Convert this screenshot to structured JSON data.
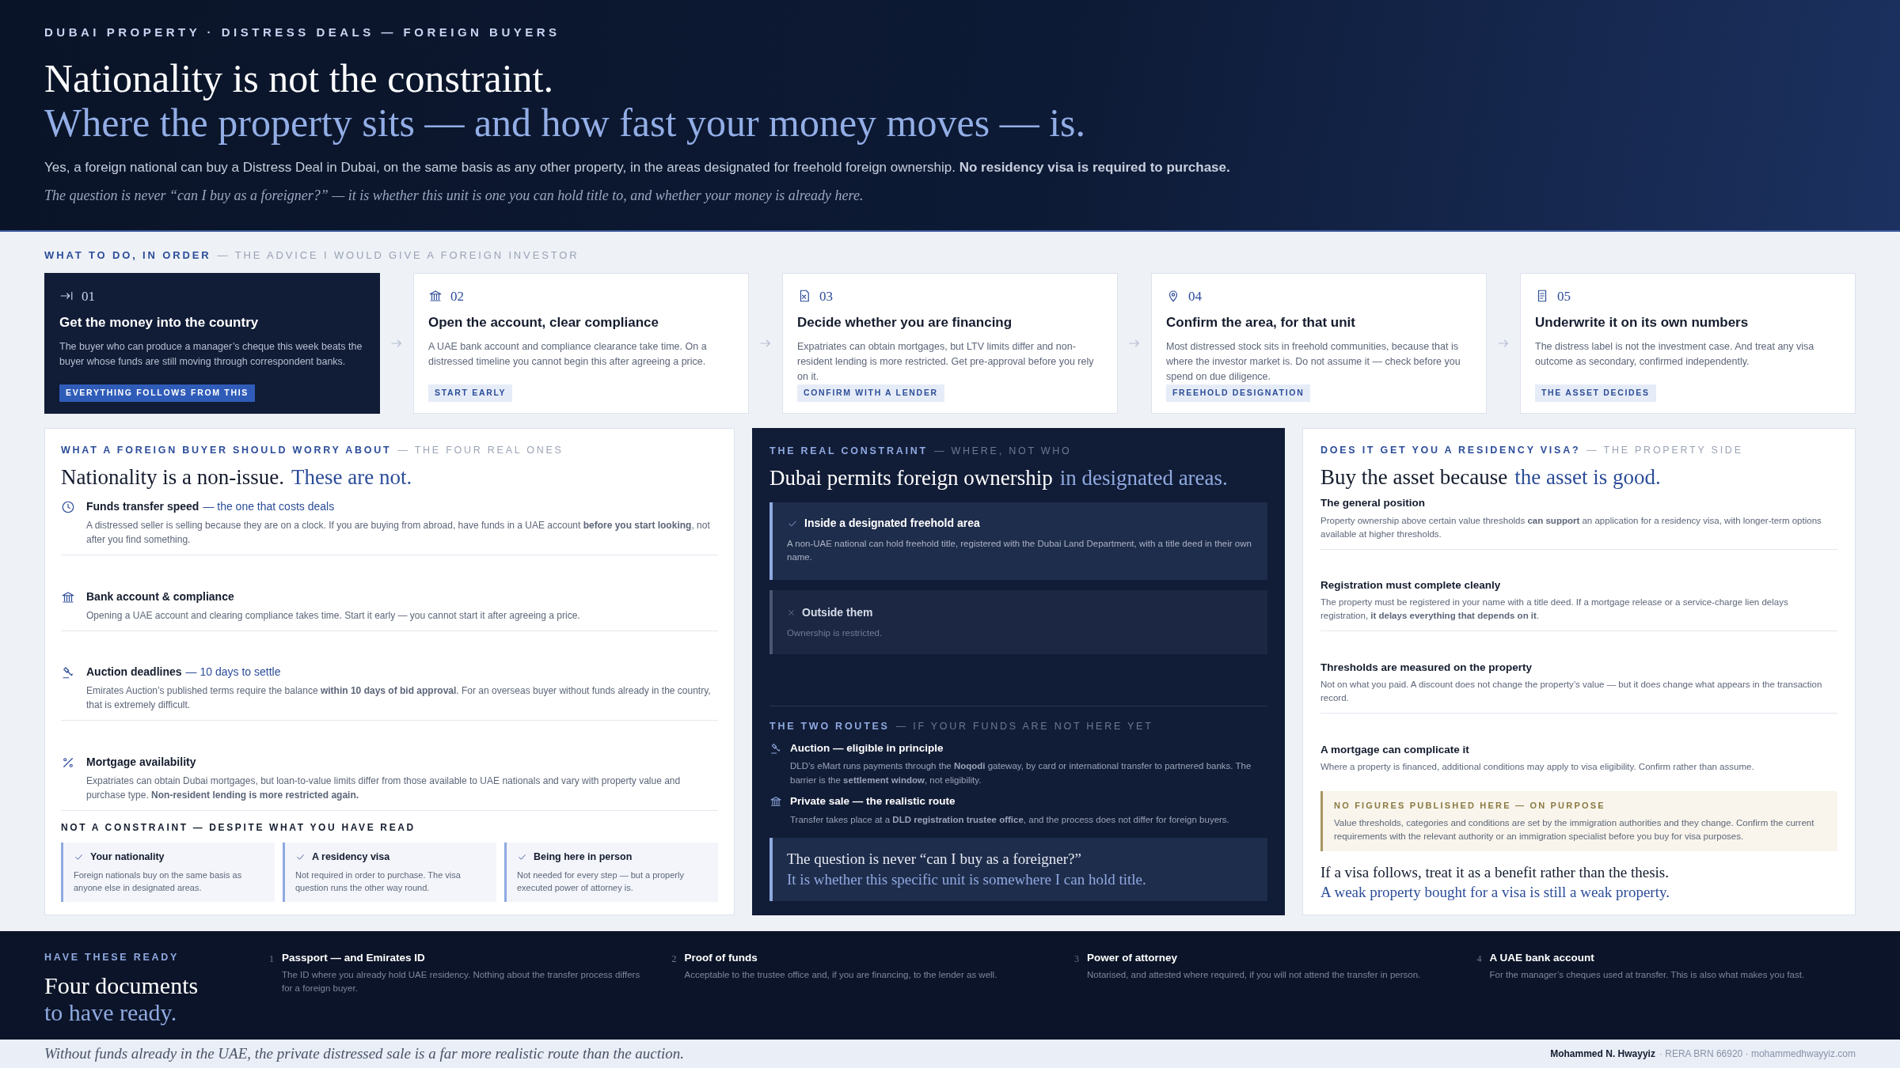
{
  "header": {
    "eyebrow": "DUBAI PROPERTY · DISTRESS DEALS — FOREIGN BUYERS",
    "title_line_1": "Nationality is not the constraint.",
    "title_line_2": "Where the property sits — and how fast your money moves — is.",
    "lede": "Yes, a foreign national can buy a Distress Deal in Dubai, on the same basis as any other property, in the areas designated for freehold foreign ownership. **No residency visa is required to purchase.**",
    "note": "The question is never “can I buy as a foreigner?” — it is whether this unit is one you can hold title to, and whether your money is already here."
  },
  "steps_section": {
    "label": "WHAT TO DO, IN ORDER",
    "label_sub": "— THE ADVICE I WOULD GIVE A FOREIGN INVESTOR",
    "steps": [
      {
        "number": "01",
        "title": "Get the money into the country",
        "body": "The buyer who can produce a manager’s cheque this week beats the buyer whose funds are still moving through correspondent banks.",
        "tag": "EVERYTHING FOLLOWS FROM THIS",
        "featured": true
      },
      {
        "number": "02",
        "title": "Open the account, clear compliance",
        "body": "A UAE bank account and compliance clearance take time. On a distressed timeline you cannot begin this after agreeing a price.",
        "tag": "START EARLY",
        "featured": false
      },
      {
        "number": "03",
        "title": "Decide whether you are financing",
        "body": "Expatriates can obtain mortgages, but LTV limits differ and non-resident lending is more restricted. Get pre-approval before you rely on it.",
        "tag": "CONFIRM WITH A LENDER",
        "featured": false
      },
      {
        "number": "04",
        "title": "Confirm the area, for that unit",
        "body": "Most distressed stock sits in freehold communities, because that is where the investor market is. Do not assume it — check before you spend on due diligence.",
        "tag": "FREEHOLD DESIGNATION",
        "featured": false
      },
      {
        "number": "05",
        "title": "Underwrite it on its own numbers",
        "body": "The distress label is not the investment case. And treat any visa outcome as secondary, confirmed independently.",
        "tag": "THE ASSET DECIDES",
        "featured": false
      }
    ]
  },
  "concerns_panel": {
    "label": "WHAT A FOREIGN BUYER SHOULD WORRY ABOUT",
    "label_sub": "— THE FOUR REAL ONES",
    "title": "Nationality is a non-issue.",
    "title_accent": "These are not.",
    "items": [
      {
        "title": "Funds transfer speed",
        "title_accent": "— the one that costs deals",
        "body": "A distressed seller is selling because they are on a clock. If you are buying from abroad, have funds in a UAE account **before you start looking**, not after you find something."
      },
      {
        "title": "Bank account & compliance",
        "body": "Opening a UAE account and clearing compliance takes time. Start it early — you cannot start it after agreeing a price."
      },
      {
        "title": "Auction deadlines",
        "title_accent": "— 10 days to settle",
        "body": "Emirates Auction’s published terms require the balance **within 10 days of bid approval**. For an overseas buyer without funds already in the country, that is extremely difficult."
      },
      {
        "title": "Mortgage availability",
        "body": "Expatriates can obtain Dubai mortgages, but loan-to-value limits differ from those available to UAE nationals and vary with property value and purchase type. **Non-resident lending is more restricted again.**"
      }
    ],
    "not_constraint": {
      "label": "NOT A CONSTRAINT — DESPITE WHAT YOU HAVE READ",
      "items": [
        {
          "title": "Your nationality",
          "body": "Foreign nationals buy on the same basis as anyone else in designated areas."
        },
        {
          "title": "A residency visa",
          "body": "Not required in order to purchase. The visa question runs the other way round."
        },
        {
          "title": "Being here in person",
          "body": "Not needed for every step — but a properly executed power of attorney is."
        }
      ]
    }
  },
  "constraint_panel": {
    "label": "THE REAL CONSTRAINT",
    "label_sub": "— WHERE, NOT WHO",
    "title": "Dubai permits foreign ownership",
    "title_accent": "in designated areas.",
    "options": [
      {
        "kind": "allowed",
        "title": "Inside a designated freehold area",
        "body": "A non-UAE national can hold freehold title, registered with the Dubai Land Department, with a title deed in their own name."
      },
      {
        "kind": "restricted",
        "title": "Outside them",
        "body": "Ownership is restricted."
      }
    ],
    "routes_label": "THE TWO ROUTES",
    "routes_label_sub": "— IF YOUR FUNDS ARE NOT HERE YET",
    "routes": [
      {
        "title": "Auction — eligible in principle",
        "body": "DLD’s eMart runs payments through the **Noqodi** gateway, by card or international transfer to partnered banks. The barrier is the **settlement window**, not eligibility."
      },
      {
        "title": "Private sale — the realistic route",
        "body": "Transfer takes place at a **DLD registration trustee office**, and the process does not differ for foreign buyers."
      }
    ],
    "quote_line_1": "The question is never “can I buy as a foreigner?”",
    "quote_line_2": "It is whether this specific unit is somewhere I can hold title."
  },
  "visa_panel": {
    "label": "DOES IT GET YOU A RESIDENCY VISA?",
    "label_sub": "— THE PROPERTY SIDE",
    "title": "Buy the asset because",
    "title_accent": "the asset is good.",
    "items": [
      {
        "title": "The general position",
        "body": "Property ownership above certain value thresholds **can support** an application for a residency visa, with longer-term options available at higher thresholds."
      },
      {
        "title": "Registration must complete cleanly",
        "body": "The property must be registered in your name with a title deed. If a mortgage release or a service-charge lien delays registration, **it delays everything that depends on it**."
      },
      {
        "title": "Thresholds are measured on the property",
        "body": "Not on what you paid. A discount does not change the property’s value — but it does change what appears in the transaction record."
      },
      {
        "title": "A mortgage can complicate it",
        "body": "Where a property is financed, additional conditions may apply to visa eligibility. Confirm rather than assume."
      }
    ],
    "notice": {
      "label": "NO FIGURES PUBLISHED HERE — ON PURPOSE",
      "body": "Value thresholds, categories and conditions are set by the immigration authorities and they change. Confirm the current requirements with the relevant authority or an immigration specialist before you buy for visa purposes."
    },
    "closing_line_1": "If a visa follows, treat it as a benefit rather than the thesis.",
    "closing_line_2": "A weak property bought for a visa is still a weak property."
  },
  "documents": {
    "label": "HAVE THESE READY",
    "title_line_1": "Four documents",
    "title_line_2": "to have ready.",
    "items": [
      {
        "number": "1",
        "title": "Passport — and Emirates ID",
        "body": "The ID where you already hold UAE residency. Nothing about the transfer process differs for a foreign buyer."
      },
      {
        "number": "2",
        "title": "Proof of funds",
        "body": "Acceptable to the trustee office and, if you are financing, to the lender as well."
      },
      {
        "number": "3",
        "title": "Power of attorney",
        "body": "Notarised, and attested where required, if you will not attend the transfer in person."
      },
      {
        "number": "4",
        "title": "A UAE bank account",
        "body": "For the manager’s cheques used at transfer. This is also what makes you fast."
      }
    ]
  },
  "footer": {
    "note": "Without funds already in the UAE, the private distressed sale is a far more realistic route than the auction.",
    "author": "Mohammed N. Hwayyiz",
    "details": "· RERA BRN 66920 · mohammedhwayyiz.com"
  }
}
